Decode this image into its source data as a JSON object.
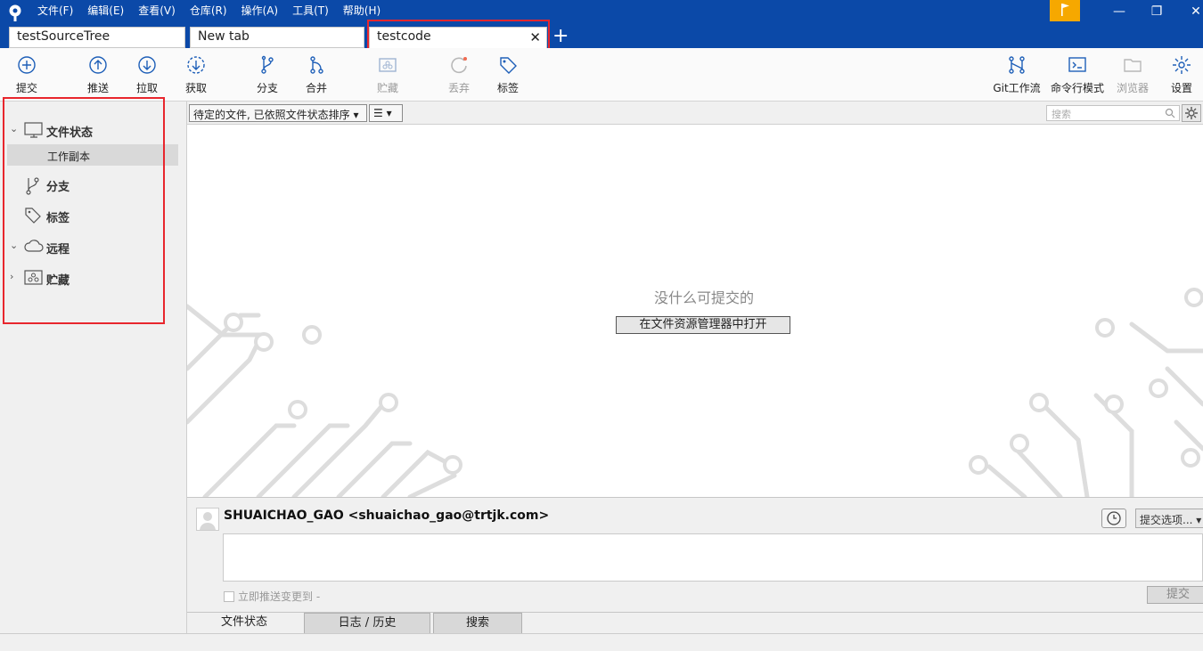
{
  "menu": [
    "文件(F)",
    "编辑(E)",
    "查看(V)",
    "仓库(R)",
    "操作(A)",
    "工具(T)",
    "帮助(H)"
  ],
  "window_controls": {
    "minimize": "—",
    "restore": "❐",
    "close": "✕"
  },
  "tabs": [
    {
      "label": "testSourceTree"
    },
    {
      "label": "New tab"
    },
    {
      "label": "testcode",
      "close": "✕"
    }
  ],
  "add_tab": "+",
  "toolbar": {
    "commit": "提交",
    "push": "推送",
    "pull": "拉取",
    "fetch": "获取",
    "branch": "分支",
    "merge": "合并",
    "stash": "贮藏",
    "discard": "丢弃",
    "tag": "标签",
    "gitflow": "Git工作流",
    "terminal": "命令行模式",
    "explorer": "浏览器",
    "settings": "设置"
  },
  "sidebar": {
    "file_status": "文件状态",
    "working_copy": "工作副本",
    "branches": "分支",
    "tags": "标签",
    "remotes": "远程",
    "stashes": "贮藏"
  },
  "filter": {
    "sort_label": "待定的文件, 已依照文件状态排序",
    "view_icon": "☰",
    "search_placeholder": "搜索"
  },
  "main": {
    "empty_message": "没什么可提交的",
    "open_explorer_button": "在文件资源管理器中打开"
  },
  "commit": {
    "author": "SHUAICHAO_GAO <shuaichao_gao@trtjk.com>",
    "options": "提交选项...",
    "push_immediately": "立即推送变更到 -",
    "commit_button": "提交"
  },
  "bottom_tabs": [
    "文件状态",
    "日志 / 历史",
    "搜索"
  ],
  "colors": {
    "titlebar": "#0b49a8",
    "accent_icon": "#1e5fb8",
    "highlight": "#e8262d",
    "flag": "#f6a800"
  }
}
